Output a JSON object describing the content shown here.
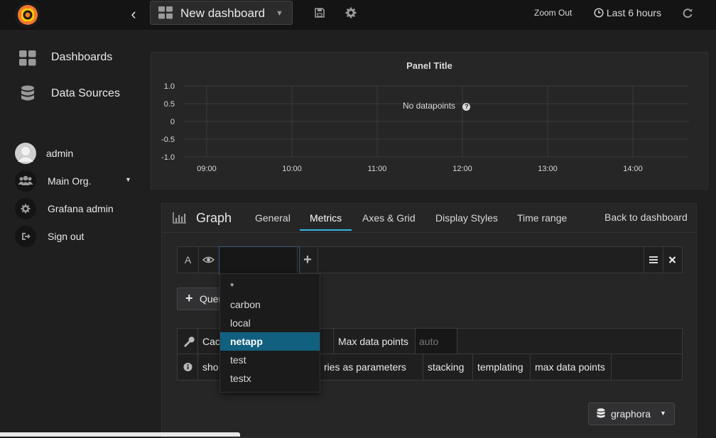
{
  "topbar": {
    "dashboard_name": "New dashboard",
    "zoom_out": "Zoom Out",
    "time_range": "Last 6 hours"
  },
  "sidebar": {
    "nav": [
      {
        "label": "Dashboards",
        "icon": "grid-icon"
      },
      {
        "label": "Data Sources",
        "icon": "database-icon"
      }
    ],
    "user": [
      {
        "label": "admin",
        "icon": "avatar"
      },
      {
        "label": "Main Org.",
        "icon": "users-icon"
      },
      {
        "label": "Grafana admin",
        "icon": "gear-icon"
      },
      {
        "label": "Sign out",
        "icon": "sign-out-icon"
      }
    ]
  },
  "panel": {
    "title": "Panel Title",
    "no_data": "No datapoints"
  },
  "chart_data": {
    "type": "line",
    "title": "Panel Title",
    "series": [],
    "x_ticks": [
      "09:00",
      "10:00",
      "11:00",
      "12:00",
      "13:00",
      "14:00"
    ],
    "y_ticks": [
      "1.0",
      "0.5",
      "0",
      "-0.5",
      "-1.0"
    ],
    "ylim": [
      -1.0,
      1.0
    ],
    "grid": true,
    "annotation": "No datapoints"
  },
  "editor": {
    "panel_type": "Graph",
    "tabs": [
      "General",
      "Metrics",
      "Axes & Grid",
      "Display Styles",
      "Time range"
    ],
    "active_tab": "Metrics",
    "back": "Back to dashboard",
    "query": {
      "ref_id": "A",
      "segment_value": ""
    },
    "add_query": "Query",
    "options": {
      "cache_label": "Cac",
      "max_points_label": "Max data points",
      "max_points_placeholder": "auto"
    },
    "help": [
      "sho",
      "ries as parameters",
      "stacking",
      "templating",
      "max data points"
    ],
    "datasource": "graphora"
  },
  "dropdown": {
    "items": [
      "*",
      "carbon",
      "local",
      "netapp",
      "test",
      "testx"
    ],
    "selected": "netapp"
  },
  "colors": {
    "accent": "#33b5e5",
    "selected": "#11607f",
    "logo_orange": "#f2762e"
  }
}
